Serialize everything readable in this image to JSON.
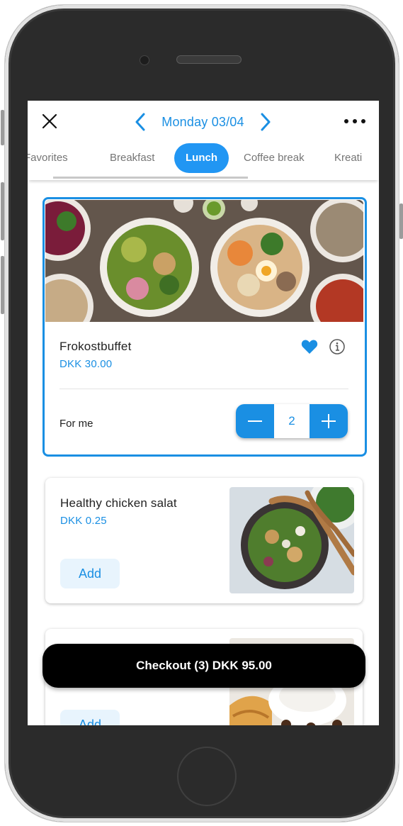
{
  "header": {
    "date_label": "Monday 03/04",
    "close_icon": "close-icon",
    "prev_icon": "chevron-left-icon",
    "next_icon": "chevron-right-icon",
    "more_icon": "more-horizontal-icon"
  },
  "tabs": [
    {
      "label": "Favorites",
      "active": false
    },
    {
      "label": "Breakfast",
      "active": false
    },
    {
      "label": "Lunch",
      "active": true
    },
    {
      "label": "Coffee break",
      "active": false
    },
    {
      "label": "Kreati",
      "active": false
    }
  ],
  "items": [
    {
      "name": "Frokostbuffet",
      "price": "DKK 30.00",
      "favorite": true,
      "for_label": "For me",
      "quantity": "2"
    },
    {
      "name": "Healthy chicken salat",
      "price": "DKK 0.25",
      "add_label": "Add"
    },
    {
      "add_label": "Add"
    }
  ],
  "checkout": {
    "label": "Checkout (3) DKK 95.00"
  },
  "colors": {
    "accent": "#1a8fe3",
    "active_tab": "#2196f3",
    "checkout_bg": "#000000"
  }
}
